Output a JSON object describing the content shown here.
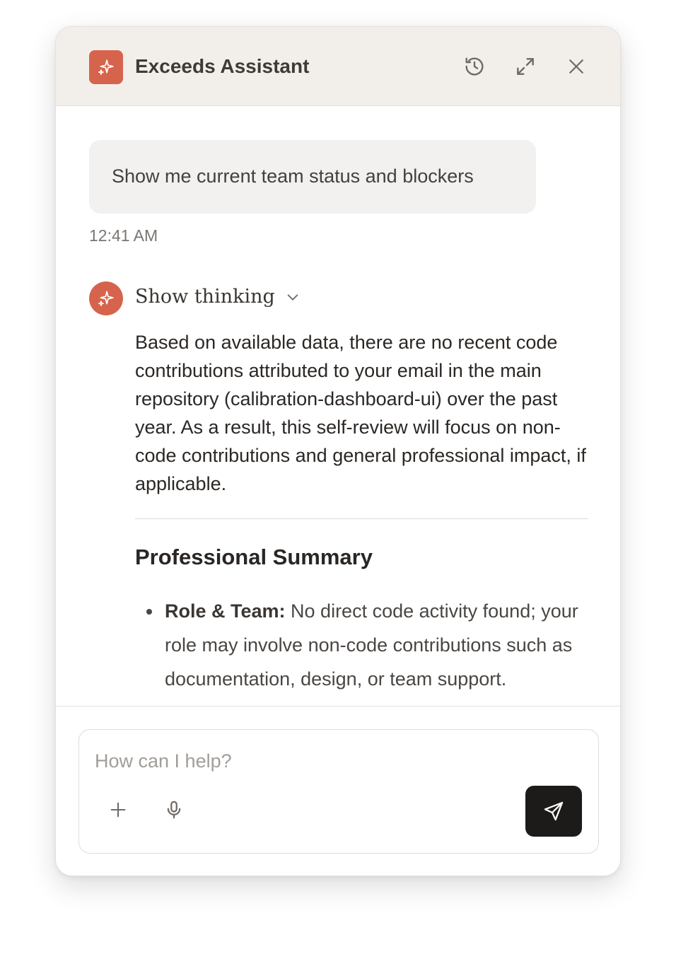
{
  "header": {
    "title": "Exceeds Assistant",
    "logo_icon": "sparkle-icon",
    "actions": [
      "history-icon",
      "expand-icon",
      "close-icon"
    ]
  },
  "conversation": {
    "user_message": "Show me current team status and blockers",
    "timestamp": "12:41 AM",
    "assistant": {
      "thinking_label": "Show thinking",
      "intro": "Based on available data, there are no recent code contributions attributed to your email in the main repository (calibration-dashboard-ui) over the past year. As a result, this self-review will focus on non-code contributions and general professional impact, if applicable.",
      "section_title": "Professional Summary",
      "bullets": [
        {
          "label": "Role & Team:",
          "text": " No direct code activity found; your role may involve non-code contributions such as documentation, design, or team support."
        }
      ]
    }
  },
  "composer": {
    "placeholder": "How can I help?",
    "value": "",
    "icons": [
      "plus-icon",
      "microphone-icon",
      "send-icon"
    ]
  },
  "colors": {
    "accent": "#d6644d",
    "header_bg": "#f2efea",
    "send_bg": "#1c1b1a"
  }
}
